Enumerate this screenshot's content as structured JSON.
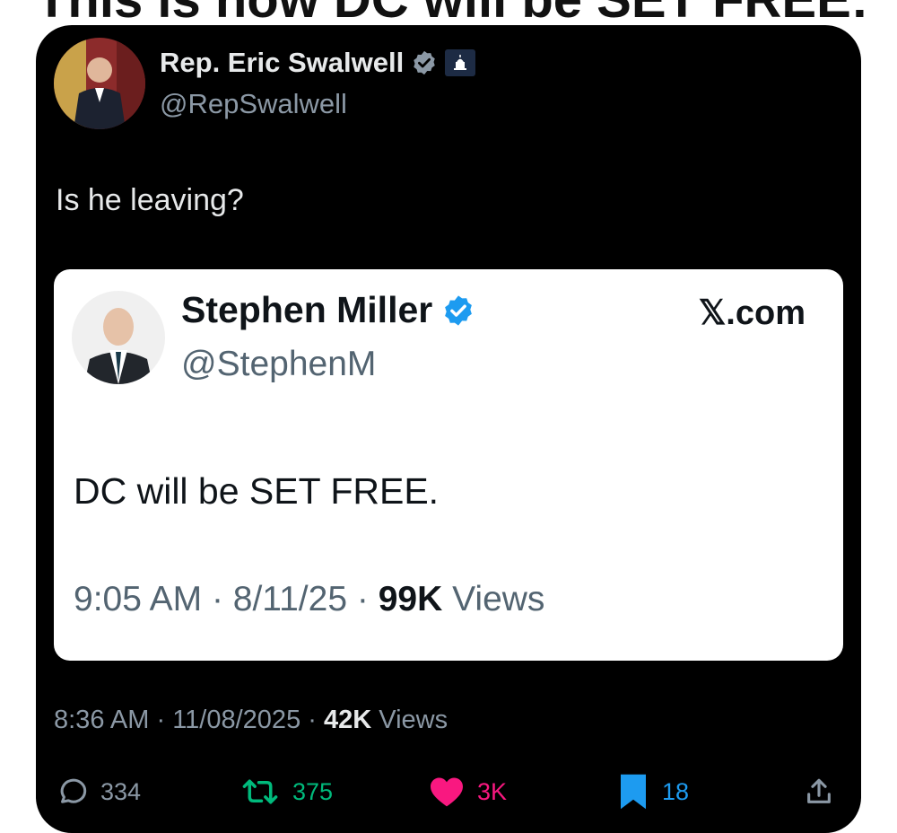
{
  "headline": "This is how DC will be SET FREE:",
  "post": {
    "author_name": "Rep. Eric Swalwell",
    "author_handle": "@RepSwalwell",
    "text": "Is he leaving?",
    "time": "8:36 AM",
    "date": "11/08/2025",
    "views_count": "42K",
    "views_label": "Views",
    "sep": "·"
  },
  "quoted": {
    "author_name": "Stephen Miller",
    "author_handle": "@StephenM",
    "site": "𝕏.com",
    "text": "DC will be SET FREE.",
    "time": "9:05 AM",
    "date": "8/11/25",
    "views_count": "99K",
    "views_label": "Views"
  },
  "actions": {
    "replies": "334",
    "reposts": "375",
    "likes": "3K",
    "bookmarks": "18"
  },
  "colors": {
    "verified": "#1d9bf0",
    "repost": "#00ba7c",
    "like": "#f91880"
  }
}
